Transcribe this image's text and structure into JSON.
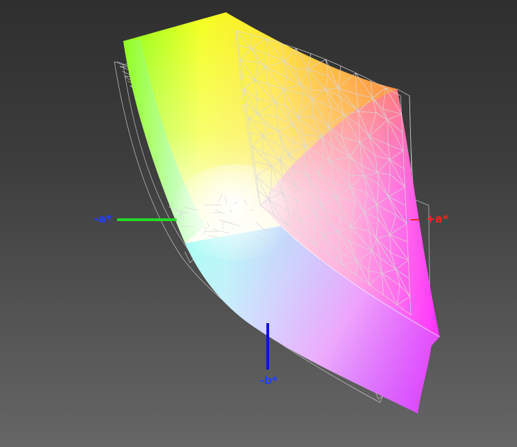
{
  "axes": {
    "neg_a": {
      "label": "-a*",
      "axis_color": "#22dd22",
      "label_color": "#2040ff"
    },
    "pos_a": {
      "label": "+a*",
      "axis_color": "#ff2020",
      "label_color": "#ff2020"
    },
    "neg_b": {
      "label": "-b*",
      "axis_color": "#1010e0",
      "label_color": "#2040ff"
    }
  },
  "colors": {
    "background_top": "#2f2f2f",
    "background_bottom": "#666666",
    "wireframe": "#d0d0d0",
    "gamut_yellow": "#ffff00",
    "gamut_green": "#90ff10",
    "gamut_orange": "#ff7a10",
    "gamut_magenta": "#ff30ff",
    "gamut_cyan": "#70ffee",
    "gamut_blue": "#9fb0ff",
    "gamut_purple": "#b040ff"
  }
}
